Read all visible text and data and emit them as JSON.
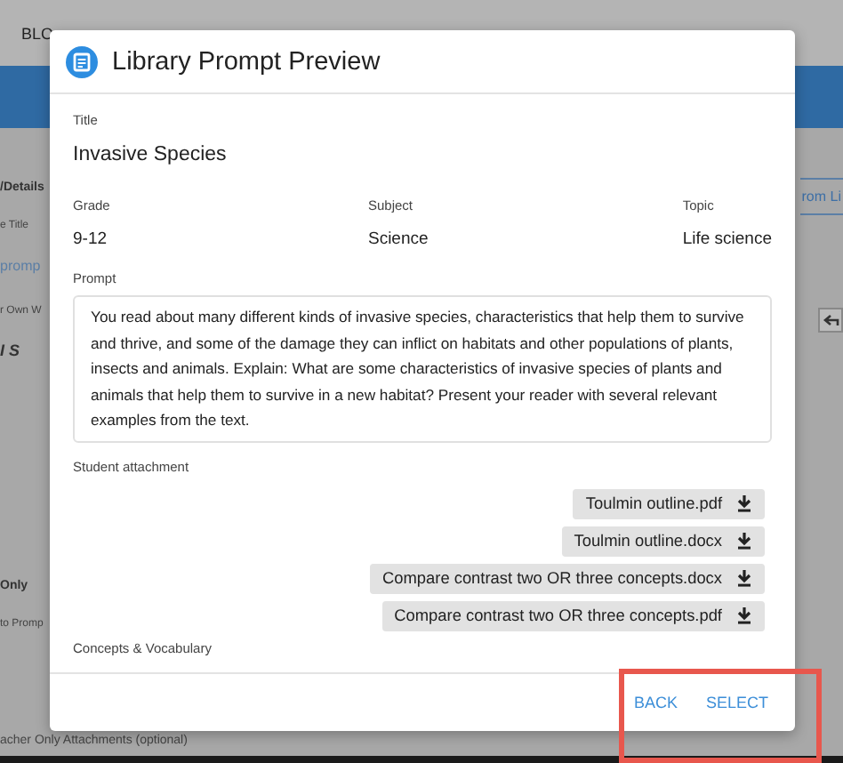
{
  "page_behind": {
    "top_bar_text": "BLO",
    "left_fragments": [
      {
        "kind": "heading",
        "text": "/Details"
      },
      {
        "kind": "label",
        "text": "e Title"
      },
      {
        "kind": "field",
        "text": "promp"
      },
      {
        "kind": "label",
        "text": "r Own W"
      },
      {
        "kind": "toolbar",
        "text": "I  S"
      },
      {
        "kind": "heading",
        "text": "Only"
      },
      {
        "kind": "label",
        "text": "to Promp"
      }
    ],
    "right_button": "rom Li",
    "bottom_text": "acher Only Attachments (optional)"
  },
  "dialog": {
    "title": "Library Prompt Preview",
    "fields": [
      {
        "label": "Title",
        "value": "Invasive Species"
      }
    ],
    "columns": [
      {
        "label": "Grade",
        "value": "9-12"
      },
      {
        "label": "Subject",
        "value": "Science"
      },
      {
        "label": "Topic",
        "value": "Life science"
      }
    ],
    "prompt_label": "Prompt",
    "prompt": "You read about many different kinds of invasive species, characteristics that help them to survive and thrive, and some of the damage they can inflict on habitats and other populations of plants, insects and animals. Explain: What are some characteristics of invasive species of plants and animals that help them to survive in a new habitat? Present your reader with several relevant examples from the text.",
    "attachment_label": "Student attachment",
    "attachments": [
      "Toulmin outline.pdf",
      "Toulmin outline.docx",
      "Compare contrast two OR three concepts.docx",
      "Compare contrast two OR three concepts.pdf"
    ],
    "next_section_label": "Concepts & Vocabulary",
    "buttons": [
      "BACK",
      "SELECT"
    ]
  },
  "highlight": {
    "on": true
  }
}
